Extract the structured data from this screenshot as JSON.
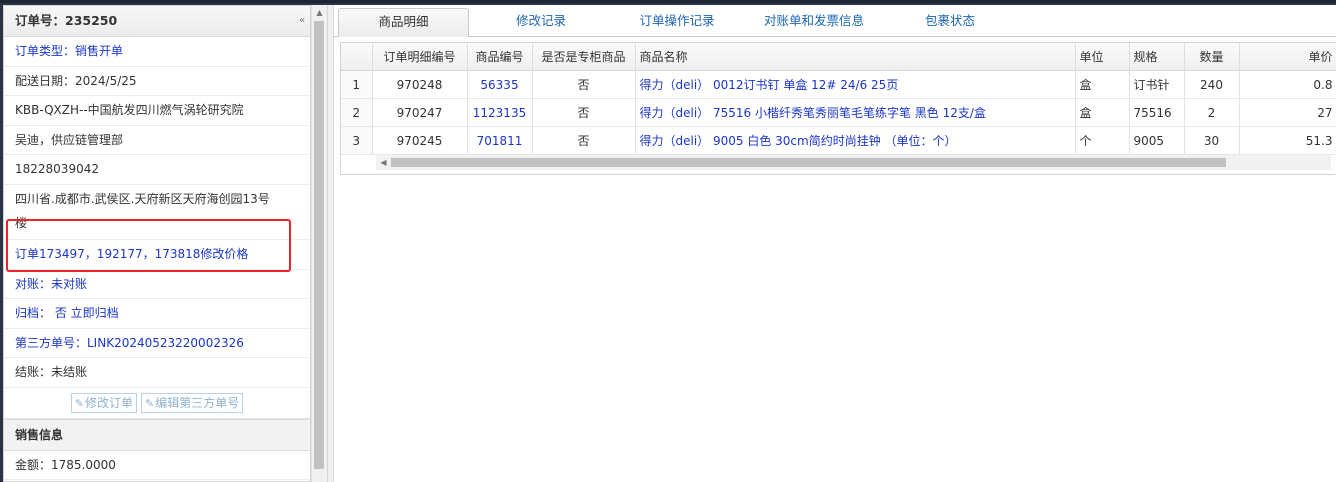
{
  "left": {
    "header": "订单号：235250",
    "order_type": "订单类型：销售开单",
    "delivery_date": "配送日期：2024/5/25",
    "customer": "KBB-QXZH--中国航发四川燃气涡轮研究院",
    "contact": "吴迪，供应链管理部",
    "phone": "18228039042",
    "address_line1": "四川省.成都市.武侯区.天府新区天府海创园13号",
    "address_line2": "楼",
    "remark": "订单173497，192177，173818修改价格",
    "reconcile": "对账：未对账",
    "archive": "归档：  否 立即归档",
    "third_party": "第三方单号：LINK20240523220002326",
    "settlement_label": "结账：",
    "settlement_value": "未结账",
    "edit_order_btn": "修改订单",
    "edit_third_btn": "编辑第三方单号",
    "sales_header": "销售信息",
    "amount": "金额：1785.0000"
  },
  "tabs": [
    {
      "label": "商品明细"
    },
    {
      "label": "修改记录"
    },
    {
      "label": "订单操作记录"
    },
    {
      "label": "对账单和发票信息"
    },
    {
      "label": "包裹状态"
    }
  ],
  "table": {
    "columns": [
      "订单明细编号",
      "商品编号",
      "是否是专柜商品",
      "商品名称",
      "单位",
      "规格",
      "数量",
      "单价"
    ],
    "rows": [
      {
        "n": "1",
        "detail_id": "970248",
        "item_no": "56335",
        "counter": "否",
        "name": "得力（deli） 0012订书钉 单盒 12# 24/6 25页",
        "unit": "盒",
        "spec": "订书针",
        "qty": "240",
        "price": "0.8"
      },
      {
        "n": "2",
        "detail_id": "970247",
        "item_no": "1123135",
        "counter": "否",
        "name": "得力（deli） 75516 小楷纤秀笔秀丽笔毛笔练字笔 黑色 12支/盒",
        "unit": "盒",
        "spec": "75516",
        "qty": "2",
        "price": "27"
      },
      {
        "n": "3",
        "detail_id": "970245",
        "item_no": "701811",
        "counter": "否",
        "name": "得力（deli） 9005 白色 30cm简约时尚挂钟 （单位：个）",
        "unit": "个",
        "spec": "9005",
        "qty": "30",
        "price": "51.3"
      }
    ]
  },
  "colors": {
    "link": "#1b36c9",
    "highlight": "#e8252a",
    "tab_link": "#1b66b3"
  },
  "icons": {
    "collapse": "chevron-double-left-icon",
    "edit": "edit-icon"
  }
}
